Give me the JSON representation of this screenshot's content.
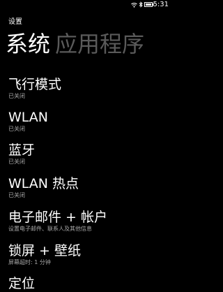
{
  "status_bar": {
    "time": "5:31",
    "icons": [
      "wifi-icon",
      "bluetooth-icon",
      "battery-icon"
    ]
  },
  "header": {
    "app_title": "设置"
  },
  "pivot": {
    "tabs": [
      {
        "label": "系统",
        "active": true
      },
      {
        "label": "应用程序",
        "active": false
      }
    ]
  },
  "settings": {
    "items": [
      {
        "title": "飞行模式",
        "subtitle": "已关闭"
      },
      {
        "title": "WLAN",
        "subtitle": "已关闭"
      },
      {
        "title": "蓝牙",
        "subtitle": "已关闭"
      },
      {
        "title": "WLAN 热点",
        "subtitle": "已关闭"
      },
      {
        "title": "电子邮件 + 帐户",
        "subtitle": "设置电子邮件、联系人及其他信息"
      },
      {
        "title": "锁屏 + 壁纸",
        "subtitle": "屏幕超时: 1 分钟"
      },
      {
        "title": "定位"
      }
    ]
  },
  "colors": {
    "background": "#000000",
    "text": "#ffffff",
    "secondary_text": "#a8a8a8",
    "inactive_tab": "#5a5a5a"
  }
}
